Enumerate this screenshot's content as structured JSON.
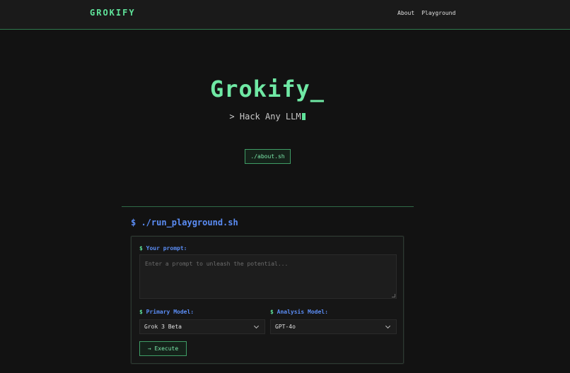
{
  "header": {
    "logo": "GROKIFY",
    "nav": [
      "About",
      "Playground"
    ]
  },
  "hero": {
    "title": "Grokify_",
    "tagline": "> Hack Any LLM",
    "about_button": "./about.sh"
  },
  "playground": {
    "section_title": "$ ./run_playground.sh",
    "prompt_label": "Your prompt:",
    "prompt_placeholder": "Enter a prompt to unleash the potential...",
    "primary_label": "Primary Model:",
    "primary_value": "Grok 3 Beta",
    "analysis_label": "Analysis Model:",
    "analysis_value": "GPT-4o",
    "dollar": "$",
    "execute_button": "→ Execute"
  },
  "colors": {
    "accent_green": "#5fe39a",
    "accent_blue": "#5b8df5",
    "background": "#121212"
  },
  "icons": [
    "chevron-down-icon",
    "cursor-block-icon"
  ]
}
